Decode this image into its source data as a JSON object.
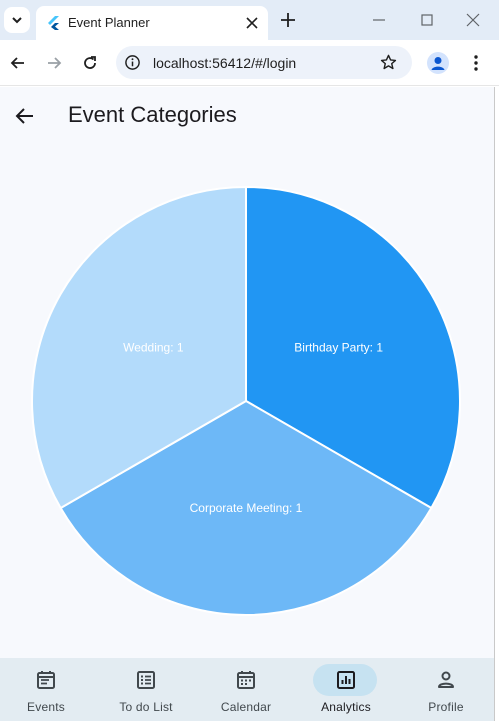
{
  "browser": {
    "tab_title": "Event Planner",
    "url": "localhost:56412/#/login"
  },
  "app": {
    "title": "Event Categories"
  },
  "chart_data": {
    "type": "pie",
    "categories": [
      "Birthday Party",
      "Corporate Meeting",
      "Wedding"
    ],
    "values": [
      1,
      1,
      1
    ],
    "labels": [
      "Birthday Party: 1",
      "Corporate Meeting: 1",
      "Wedding: 1"
    ],
    "colors": [
      "#2196f3",
      "#6db8f7",
      "#b3dbfb"
    ]
  },
  "bottom_nav": {
    "items": [
      {
        "label": "Events",
        "icon": "event-icon",
        "active": false
      },
      {
        "label": "To do List",
        "icon": "list-icon",
        "active": false
      },
      {
        "label": "Calendar",
        "icon": "calendar-icon",
        "active": false
      },
      {
        "label": "Analytics",
        "icon": "analytics-icon",
        "active": true
      },
      {
        "label": "Profile",
        "icon": "person-icon",
        "active": false
      }
    ]
  }
}
